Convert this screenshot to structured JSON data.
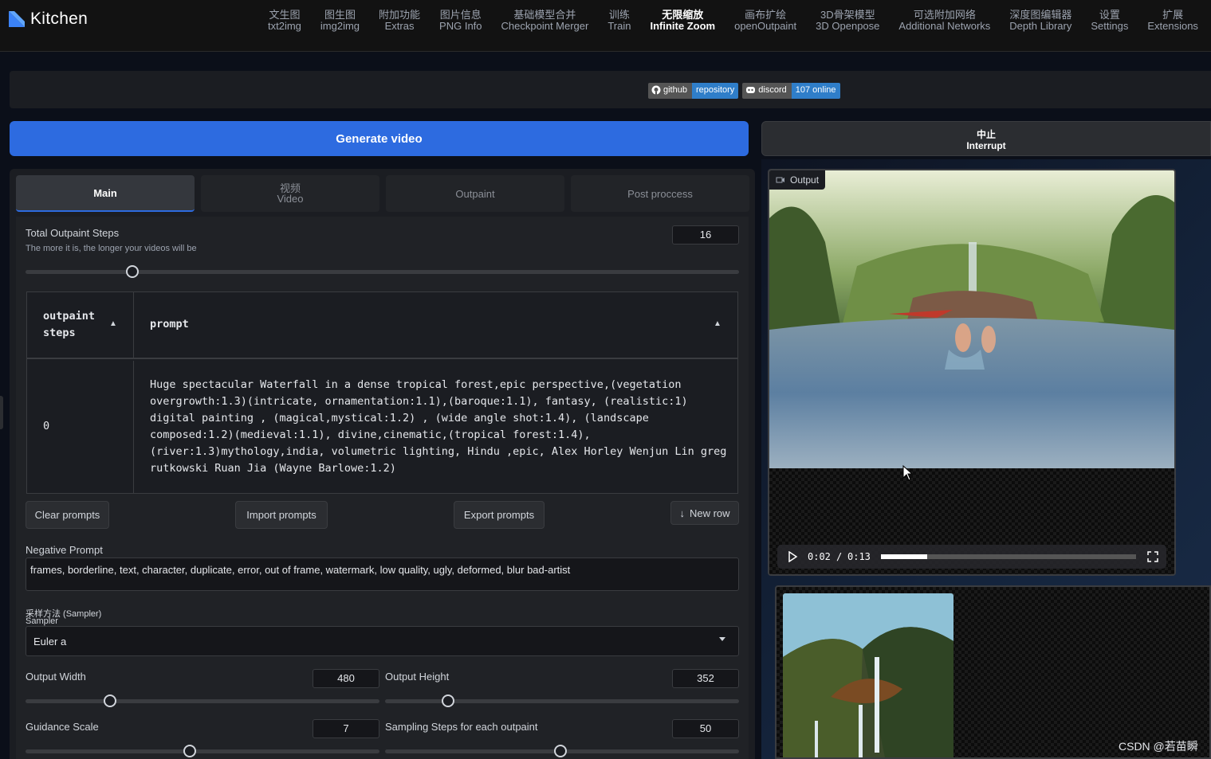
{
  "app": {
    "name": "Kitchen"
  },
  "nav": [
    {
      "zh": "文生图",
      "en": "txt2img",
      "active": false
    },
    {
      "zh": "图生图",
      "en": "img2img",
      "active": false
    },
    {
      "zh": "附加功能",
      "en": "Extras",
      "active": false
    },
    {
      "zh": "图片信息",
      "en": "PNG Info",
      "active": false
    },
    {
      "zh": "基础模型合并",
      "en": "Checkpoint Merger",
      "active": false
    },
    {
      "zh": "训练",
      "en": "Train",
      "active": false
    },
    {
      "zh": "无限缩放",
      "en": "Infinite Zoom",
      "active": true
    },
    {
      "zh": "画布扩绘",
      "en": "openOutpaint",
      "active": false
    },
    {
      "zh": "3D骨架模型",
      "en": "3D Openpose",
      "active": false
    },
    {
      "zh": "可选附加网络",
      "en": "Additional Networks",
      "active": false
    },
    {
      "zh": "深度图编辑器",
      "en": "Depth Library",
      "active": false
    },
    {
      "zh": "设置",
      "en": "Settings",
      "active": false
    },
    {
      "zh": "扩展",
      "en": "Extensions",
      "active": false
    }
  ],
  "badges": [
    {
      "label": "github",
      "value": "repository",
      "icon": "github-icon"
    },
    {
      "label": "discord",
      "value": "107 online",
      "icon": "discord-icon"
    }
  ],
  "actions": {
    "generate": "Generate video",
    "interrupt_zh": "中止",
    "interrupt_en": "Interrupt"
  },
  "tabs": [
    {
      "label": "Main",
      "zh": "",
      "active": true
    },
    {
      "label": "Video",
      "zh": "视频",
      "active": false
    },
    {
      "label": "Outpaint",
      "zh": "",
      "active": false
    },
    {
      "label": "Post proccess",
      "zh": "",
      "active": false
    }
  ],
  "outpaint_steps": {
    "label": "Total Outpaint Steps",
    "hint": "The more it is, the longer your videos will be",
    "value": "16",
    "fraction": 0.15
  },
  "prompt_table": {
    "col1": "outpaint steps",
    "col2": "prompt",
    "rows": [
      {
        "step": "0",
        "prompt": "Huge spectacular Waterfall in a dense tropical forest,epic perspective,(vegetation overgrowth:1.3)(intricate, ornamentation:1.1),(baroque:1.1), fantasy, (realistic:1) digital painting , (magical,mystical:1.2) , (wide angle shot:1.4), (landscape composed:1.2)(medieval:1.1), divine,cinematic,(tropical forest:1.4),(river:1.3)mythology,india, volumetric lighting, Hindu ,epic, Alex Horley Wenjun Lin greg rutkowski Ruan Jia (Wayne Barlowe:1.2)"
      }
    ]
  },
  "prompt_buttons": {
    "clear": "Clear prompts",
    "import": "Import prompts",
    "export": "Export prompts",
    "new_row": "New row"
  },
  "negative_prompt": {
    "label": "Negative Prompt",
    "value": "frames, borderline, text, character, duplicate, error, out of frame, watermark, low quality, ugly, deformed, blur  bad-artist"
  },
  "sampler": {
    "label_zh": "采样方法 (Sampler)",
    "label_en": "Sampler",
    "value": "Euler a"
  },
  "sliders": {
    "width": {
      "label": "Output Width",
      "value": "480",
      "fraction": 0.24
    },
    "height": {
      "label": "Output Height",
      "value": "352",
      "fraction": 0.17
    },
    "guidance": {
      "label": "Guidance Scale",
      "value": "7",
      "fraction": 0.46
    },
    "steps": {
      "label": "Sampling Steps for each outpaint",
      "value": "50",
      "fraction": 0.49
    }
  },
  "output": {
    "label": "Output",
    "time_current": "0:02",
    "time_total": "0:13",
    "progress": 0.18
  },
  "watermark": "CSDN @若苗瞬",
  "colors": {
    "accent": "#2d6be0",
    "background": "#0b0f19",
    "panel": "#1b1d22"
  }
}
